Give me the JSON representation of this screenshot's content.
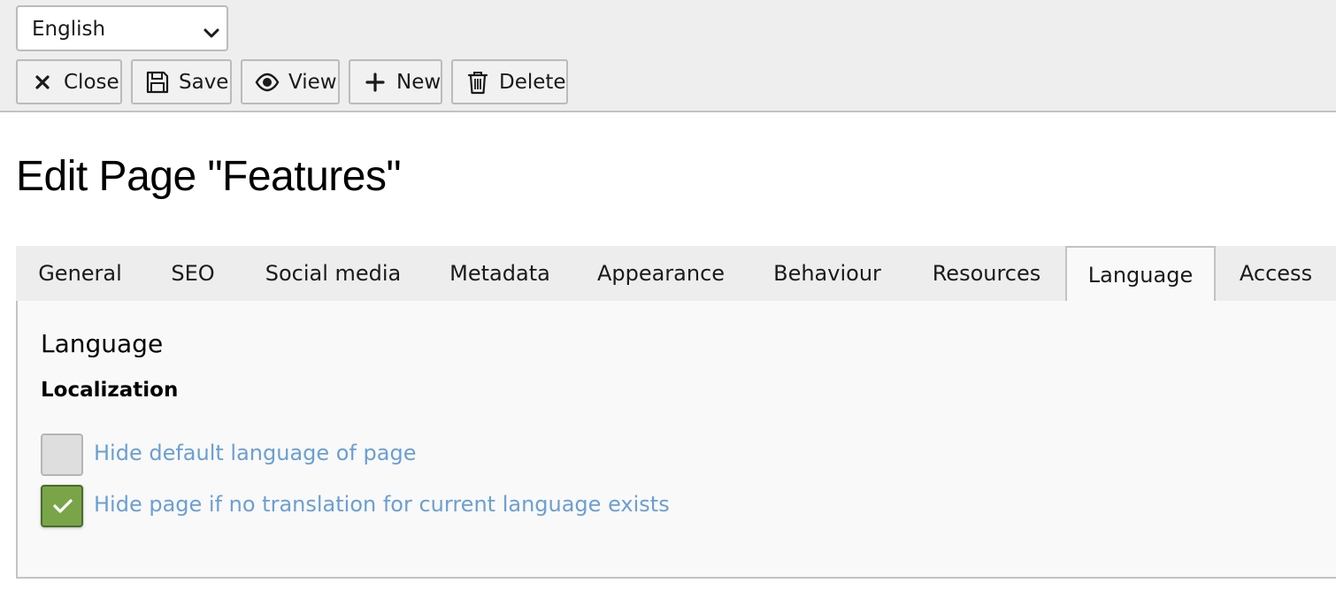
{
  "toolbar": {
    "language_select": {
      "value": "English"
    },
    "buttons": [
      {
        "label": "Close",
        "icon": "close-icon"
      },
      {
        "label": "Save",
        "icon": "save-icon"
      },
      {
        "label": "View",
        "icon": "eye-icon"
      },
      {
        "label": "New",
        "icon": "plus-icon"
      },
      {
        "label": "Delete",
        "icon": "trash-icon"
      }
    ]
  },
  "page": {
    "title": "Edit Page \"Features\""
  },
  "tabs": [
    {
      "label": "General"
    },
    {
      "label": "SEO"
    },
    {
      "label": "Social media"
    },
    {
      "label": "Metadata"
    },
    {
      "label": "Appearance"
    },
    {
      "label": "Behaviour"
    },
    {
      "label": "Resources"
    },
    {
      "label": "Language",
      "active": true
    },
    {
      "label": "Access"
    }
  ],
  "panel": {
    "section_title": "Language",
    "subsection_title": "Localization",
    "checkboxes": [
      {
        "label": "Hide default language of page",
        "checked": false
      },
      {
        "label": "Hide page if no translation for current language exists",
        "checked": true
      }
    ]
  },
  "colors": {
    "accent_green": "#79a548",
    "link_blue": "#6b9fd1",
    "header_bg": "#eeeeee"
  }
}
